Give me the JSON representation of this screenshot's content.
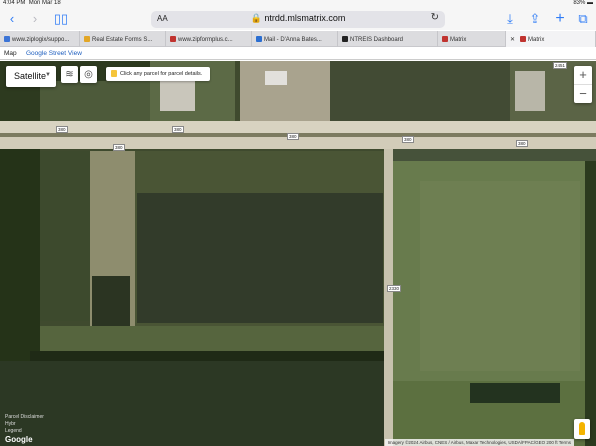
{
  "status_bar": {
    "time": "4:04 PM",
    "date": "Mon Mar 18",
    "battery": "83%"
  },
  "browser": {
    "url_prefix": "AA",
    "url": "ntrdd.mlsmatrix.com",
    "tabs": [
      {
        "label": "www.ziplogix/suppo...",
        "color": "#3c74d6"
      },
      {
        "label": "Real Estate Forms S...",
        "color": "#e2a626"
      },
      {
        "label": "www.zipformplus.c...",
        "color": "#c0332f"
      },
      {
        "label": "Mail - D'Anna Bates...",
        "color": "#2b6ed1"
      },
      {
        "label": "NTREIS Dashboard",
        "color": "#222222"
      },
      {
        "label": "Matrix",
        "color": "#c0332f"
      },
      {
        "label": "Matrix",
        "color": "#c0332f"
      }
    ]
  },
  "map_tabs": {
    "map": "Map",
    "street_view": "Google Street View"
  },
  "map": {
    "type_label": "Satellite",
    "hint": "Click any parcel for parcel details.",
    "zoom_in": "+",
    "zoom_out": "−",
    "road_labels": [
      "380",
      "380",
      "380",
      "380",
      "380",
      "380",
      "2451",
      "2330"
    ],
    "legend": [
      "Parcel Disclaimer",
      "Hybr",
      "Legend"
    ],
    "google": "Google",
    "attribution": "Imagery ©2024 Airbus, CNES / Airbus, Maxar Technologies, USDA/FPAC/GEO   200 ft   Terms"
  }
}
